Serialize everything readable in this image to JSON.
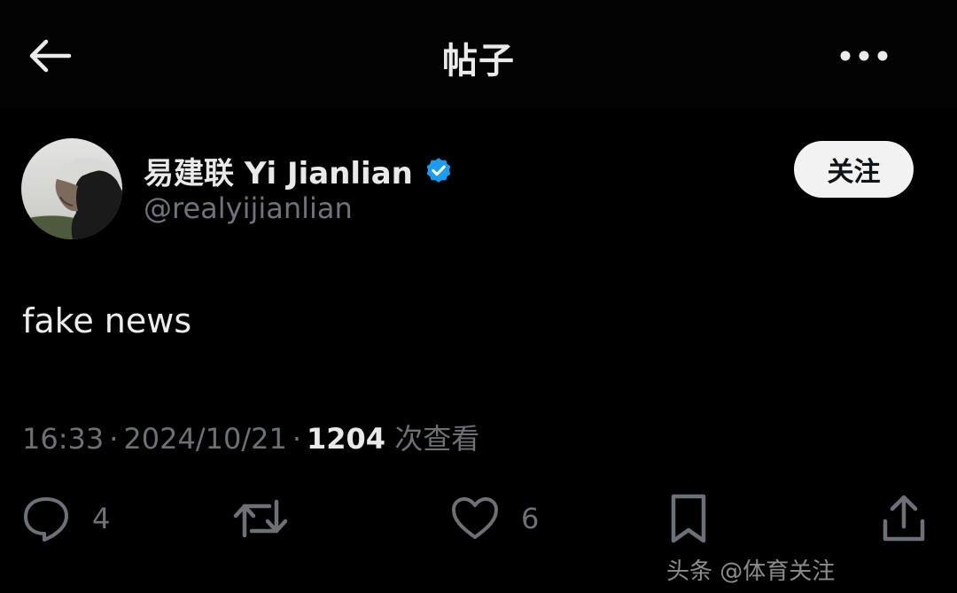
{
  "header": {
    "title": "帖子",
    "back_icon": "arrow-left-icon",
    "more_icon": "more-horizontal-icon"
  },
  "author": {
    "name": "易建联 Yi Jianlian",
    "handle": "@realyijianlian",
    "verified": true,
    "verified_color": "#1d9bf0",
    "follow_label": "关注"
  },
  "post": {
    "text": "fake news",
    "time": "16:33",
    "date": "2024/10/21",
    "views_count": "1204",
    "views_label": "次查看"
  },
  "actions": {
    "reply_count": "4",
    "repost_count": "",
    "like_count": "6",
    "bookmark_count": "",
    "icons": [
      "reply-icon",
      "repost-icon",
      "like-icon",
      "bookmark-icon",
      "share-icon"
    ]
  },
  "watermark": {
    "text": "头条 @体育关注"
  },
  "colors": {
    "background": "#000000",
    "primary_text": "#e7e9ea",
    "secondary_text": "#6d7176",
    "follow_button_bg": "#f2f2f2"
  }
}
